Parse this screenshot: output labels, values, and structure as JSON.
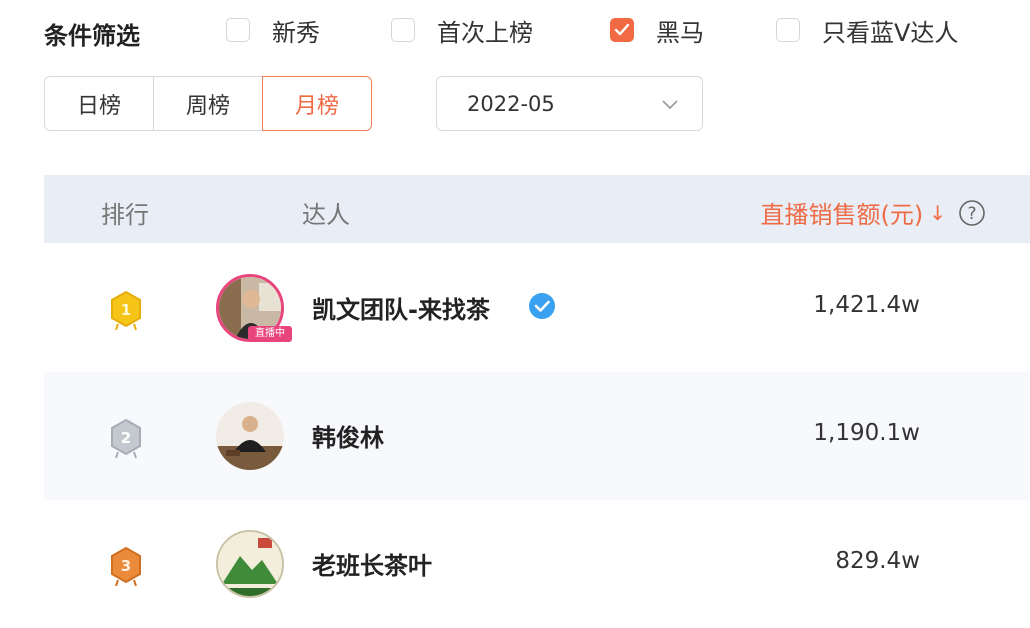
{
  "filters": {
    "title": "条件筛选",
    "options": [
      {
        "label": "新秀",
        "checked": false
      },
      {
        "label": "首次上榜",
        "checked": false
      },
      {
        "label": "黑马",
        "checked": true
      },
      {
        "label": "只看蓝V达人",
        "checked": false
      }
    ]
  },
  "period_tabs": [
    {
      "label": "日榜",
      "active": false
    },
    {
      "label": "周榜",
      "active": false
    },
    {
      "label": "月榜",
      "active": true
    }
  ],
  "date_select": {
    "value": "2022-05",
    "icon": "chevron-down-icon"
  },
  "table": {
    "headers": {
      "rank": "排行",
      "influencer": "达人",
      "sales": "直播销售额(元)",
      "sort_icon": "arrow-down-icon",
      "help_icon": "question-circle-icon"
    },
    "rows": [
      {
        "rank": 1,
        "medal_label": "1",
        "name": "凯文团队-来找茶",
        "verified": true,
        "live_tag": "直播中",
        "amount": "1,421.4w"
      },
      {
        "rank": 2,
        "medal_label": "2",
        "name": "韩俊林",
        "verified": false,
        "live_tag": "",
        "amount": "1,190.1w"
      },
      {
        "rank": 3,
        "medal_label": "3",
        "name": "老班长茶叶",
        "verified": false,
        "live_tag": "",
        "amount": "829.4w"
      }
    ]
  },
  "colors": {
    "accent": "#f26a44",
    "header_bg": "#e9eef6",
    "gold": "#f5c518",
    "silver": "#b9bec7",
    "bronze": "#e8873a",
    "live_pink": "#e8457d",
    "verified_blue": "#3aa0f0"
  }
}
